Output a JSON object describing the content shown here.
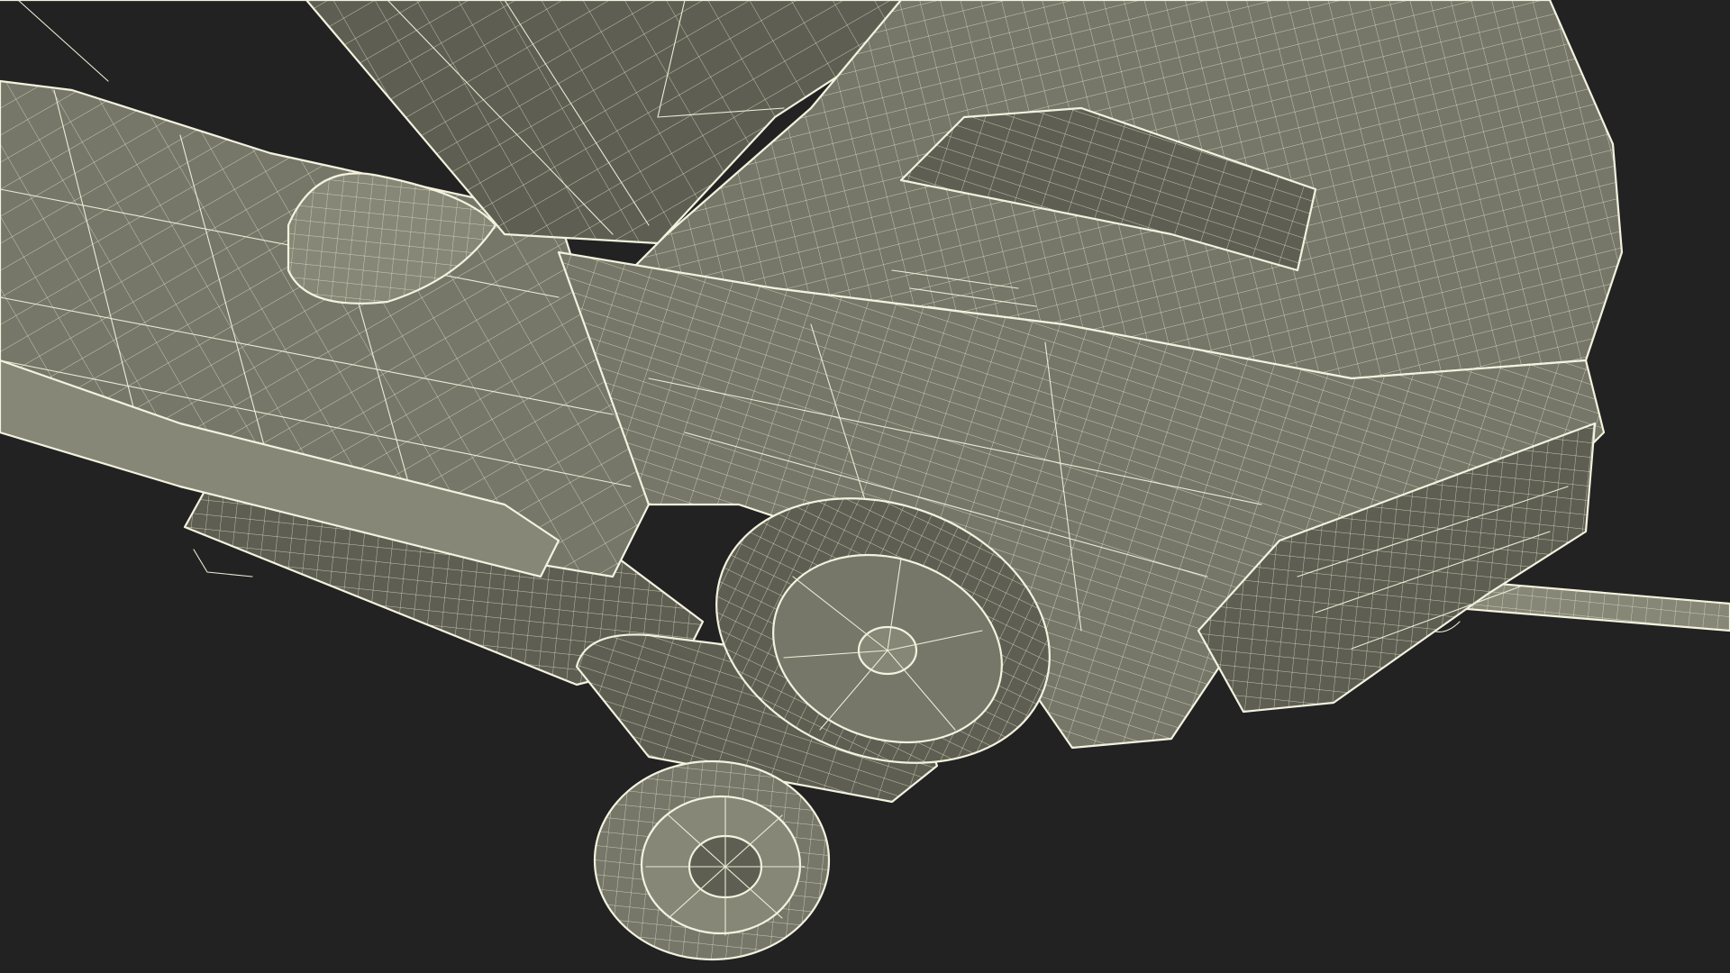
{
  "scene": {
    "subject": "wireframe-car-on-tow-dolly",
    "render_mode": "wireframe-on-shaded",
    "colors": {
      "background": "#222222",
      "surface": "#767768",
      "wire": "#ecebd6"
    }
  }
}
